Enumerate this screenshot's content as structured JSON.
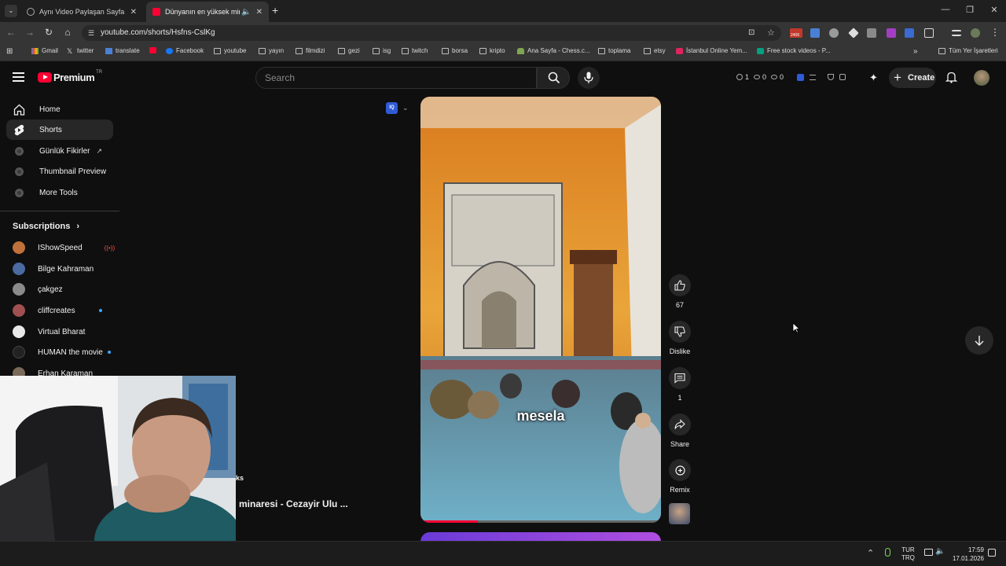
{
  "browser": {
    "tabs": [
      {
        "title": "Aynı Video Paylaşan Sayfa",
        "active": false
      },
      {
        "title": "Dünyanın en yüksek minare",
        "active": true
      }
    ],
    "url": "youtube.com/shorts/Hsfns-CslKg",
    "bookmarks": [
      "Gmail",
      "twitter",
      "translate",
      "Facebook",
      "youtube",
      "yayın",
      "filmdizi",
      "gezi",
      "isg",
      "twitch",
      "borsa",
      "kripto",
      "Ana Sayfa - Chess.c...",
      "toplama",
      "etsy",
      "İstanbul Online Yem...",
      "Free stock videos - P..."
    ],
    "bookmarks_all": "Tüm Yer İşaretleri",
    "ext_badge": "2406"
  },
  "youtube": {
    "logo": "Premium",
    "logo_sup": "TR",
    "search_placeholder": "Search",
    "stats": [
      "1",
      "0",
      "0"
    ],
    "create_label": "Create"
  },
  "sidebar": {
    "items": [
      {
        "label": "Home",
        "icon": "home-icon"
      },
      {
        "label": "Shorts",
        "icon": "shorts-icon"
      },
      {
        "label": "Günlük Fikirler",
        "icon": "ext-icon"
      },
      {
        "label": "Thumbnail Preview",
        "icon": "ext-icon"
      },
      {
        "label": "More Tools",
        "icon": "ext-icon"
      }
    ],
    "subscriptions_title": "Subscriptions",
    "subscriptions": [
      {
        "name": "IShowSpeed",
        "color": "#c0703a"
      },
      {
        "name": "Bilge Kahraman",
        "color": "#4a6aa0"
      },
      {
        "name": "çakgez",
        "color": "#8a8a8a"
      },
      {
        "name": "cliffcreates",
        "color": "#a05050"
      },
      {
        "name": "Virtual Bharat",
        "color": "#e8e8e8"
      },
      {
        "name": "HUMAN the movie",
        "color": "#222222"
      },
      {
        "name": "Erhan Karaman",
        "color": "#7a6a5a"
      }
    ]
  },
  "short": {
    "caption": "mesela",
    "title_fragment": "minaresi - Cezayir Ulu ...",
    "tag_fragment": "ks",
    "likes": "67",
    "dislike_label": "Dislike",
    "comments": "1",
    "share_label": "Share",
    "remix_label": "Remix"
  },
  "taskbar": {
    "lang_top": "TUR",
    "lang_bottom": "TRQ",
    "time": "17:59",
    "date": "17.01.2026"
  }
}
